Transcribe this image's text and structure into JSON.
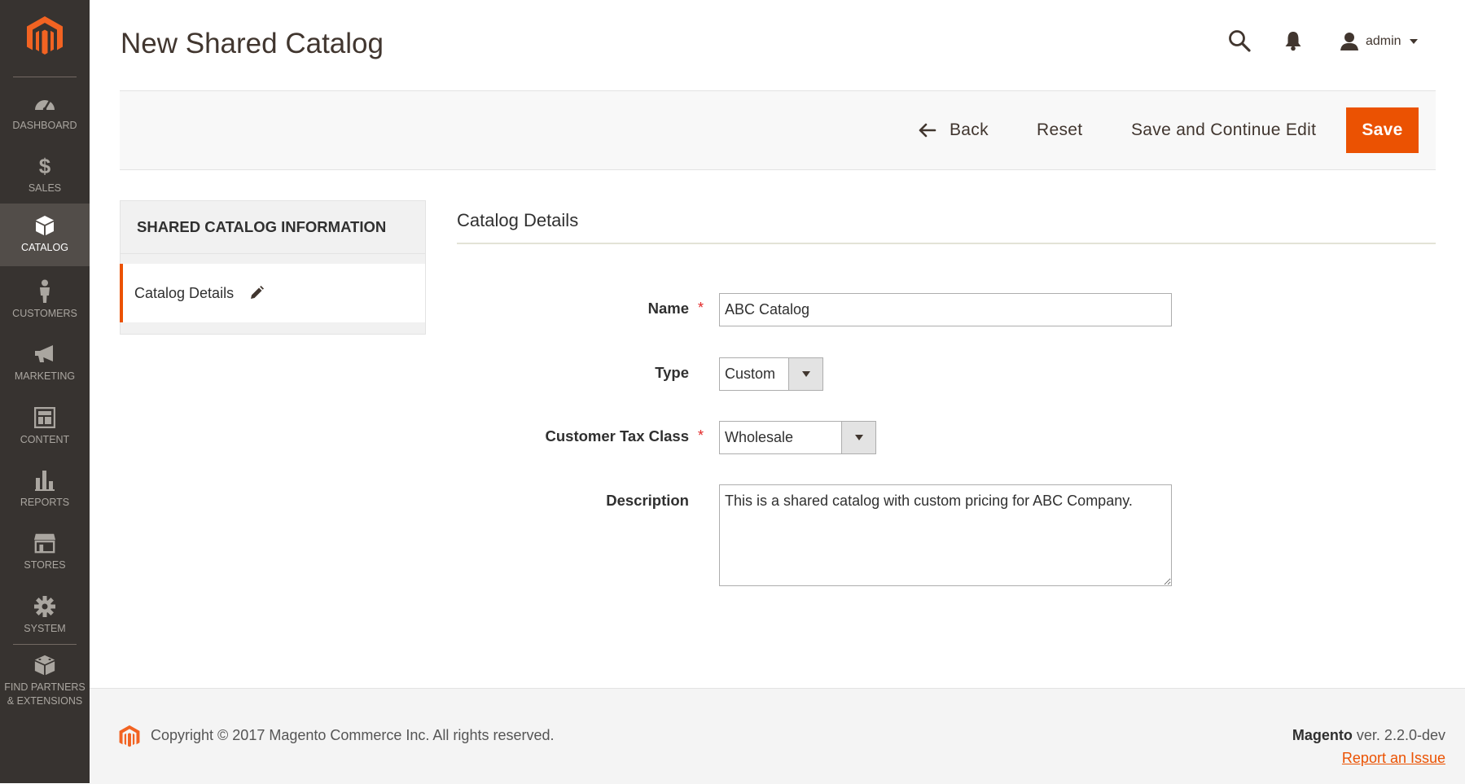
{
  "page": {
    "title": "New Shared Catalog"
  },
  "header": {
    "user_name": "admin"
  },
  "sidebar": {
    "items": [
      {
        "label": "DASHBOARD",
        "icon": "dashboard-icon"
      },
      {
        "label": "SALES",
        "icon": "dollar-icon"
      },
      {
        "label": "CATALOG",
        "icon": "box-icon",
        "active": true
      },
      {
        "label": "CUSTOMERS",
        "icon": "person-icon"
      },
      {
        "label": "MARKETING",
        "icon": "megaphone-icon"
      },
      {
        "label": "CONTENT",
        "icon": "layout-icon"
      },
      {
        "label": "REPORTS",
        "icon": "bar-chart-icon"
      },
      {
        "label": "STORES",
        "icon": "store-icon"
      },
      {
        "label": "SYSTEM",
        "icon": "gear-icon"
      },
      {
        "label": "FIND PARTNERS & EXTENSIONS",
        "icon": "blocks-icon"
      }
    ]
  },
  "toolbar": {
    "back_label": "Back",
    "reset_label": "Reset",
    "save_continue_label": "Save and Continue Edit",
    "save_label": "Save"
  },
  "info_panel": {
    "heading": "SHARED CATALOG INFORMATION",
    "tab_label": "Catalog Details"
  },
  "form": {
    "section_title": "Catalog Details",
    "name_label": "Name",
    "name_value": "ABC Catalog",
    "type_label": "Type",
    "type_value": "Custom",
    "tax_label": "Customer Tax Class",
    "tax_value": "Wholesale",
    "description_label": "Description",
    "description_value": "This is a shared catalog with custom pricing for ABC Company."
  },
  "footer": {
    "copyright": "Copyright © 2017 Magento Commerce Inc. All rights reserved.",
    "brand": "Magento",
    "version": " ver. 2.2.0-dev",
    "report_label": "Report an Issue"
  },
  "colors": {
    "accent": "#eb5202",
    "sidebar_bg": "#373330",
    "sidebar_active": "#524d49",
    "required": "#e22626"
  }
}
